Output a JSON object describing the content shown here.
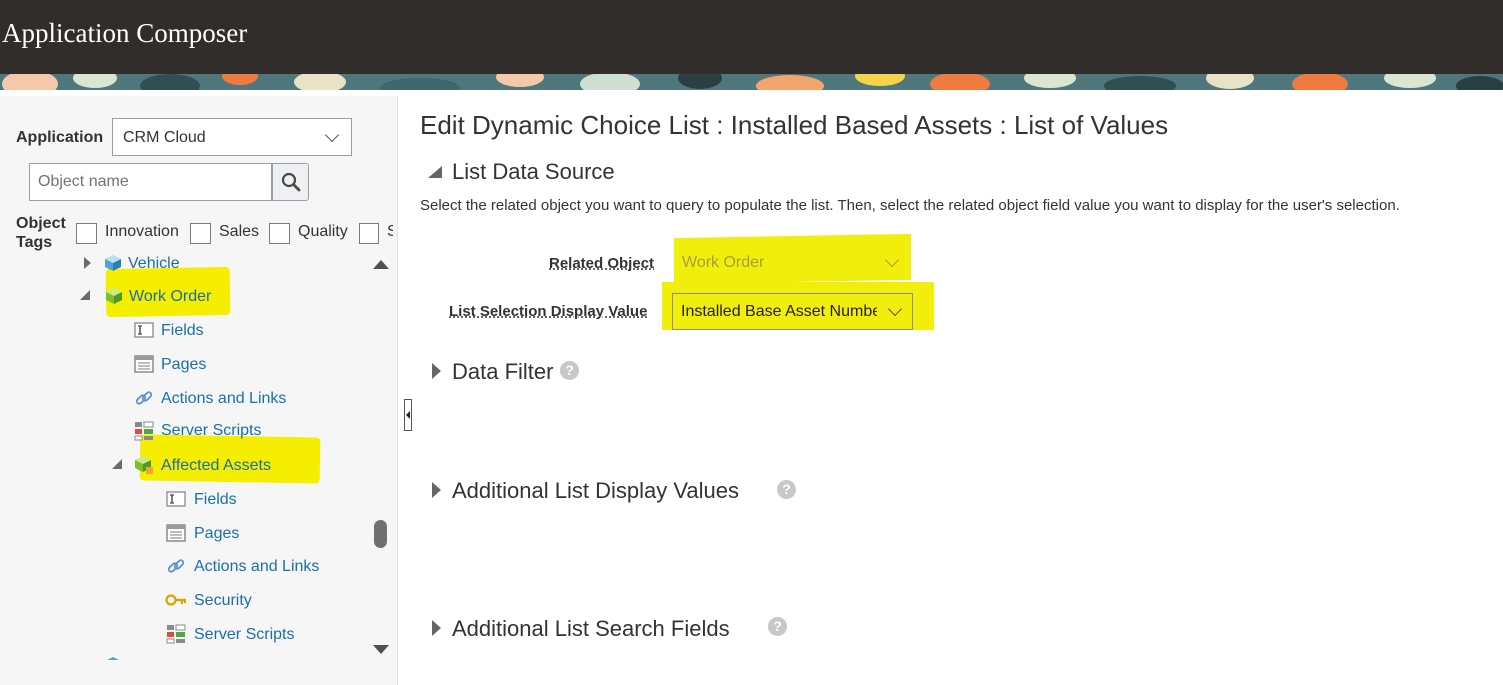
{
  "header": {
    "title": "Application Composer"
  },
  "colors": {
    "header_bg": "#312d2a",
    "link": "#1b6fa8",
    "highlight": "#f5ee00"
  },
  "left_panel": {
    "application_label": "Application",
    "application_value": "CRM Cloud",
    "object_search_placeholder": "Object name",
    "object_tags_label": "Object Tags",
    "tags": [
      "Innovation",
      "Sales",
      "Quality",
      "S"
    ],
    "tree": [
      {
        "label": "Vehicle",
        "icon": "object-cube-icon",
        "state": "collapsed"
      },
      {
        "label": "Work Order",
        "icon": "object-cube-icon",
        "state": "expanded",
        "highlighted": true
      },
      {
        "label": "Fields",
        "icon": "fields-icon"
      },
      {
        "label": "Pages",
        "icon": "pages-icon"
      },
      {
        "label": "Actions and Links",
        "icon": "link-icon"
      },
      {
        "label": "Server Scripts",
        "icon": "server-scripts-icon"
      },
      {
        "label": "Affected Assets",
        "icon": "child-object-icon",
        "state": "expanded",
        "highlighted": true
      },
      {
        "label": "Fields",
        "icon": "fields-icon"
      },
      {
        "label": "Pages",
        "icon": "pages-icon"
      },
      {
        "label": "Actions and Links",
        "icon": "link-icon"
      },
      {
        "label": "Security",
        "icon": "key-icon"
      },
      {
        "label": "Server Scripts",
        "icon": "server-scripts-icon"
      }
    ]
  },
  "main": {
    "title": "Edit Dynamic Choice List : Installed Based Assets : List of Values",
    "list_data_source": {
      "title": "List Data Source",
      "description": "Select the related object you want to query to populate the list. Then, select the related object field value you want to display for the user's selection.",
      "related_object_label": "Related Object",
      "related_object_value": "Work Order",
      "display_value_label": "List Selection Display Value",
      "display_value_value": "Installed Base Asset Number"
    },
    "sections": [
      {
        "title": "Data Filter",
        "help": "?"
      },
      {
        "title": "Additional List Display Values",
        "help": "?"
      },
      {
        "title": "Additional List Search Fields",
        "help": "?"
      }
    ]
  }
}
